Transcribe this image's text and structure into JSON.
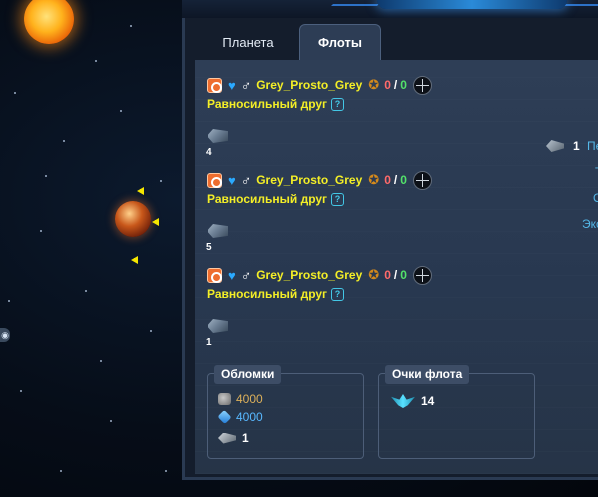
{
  "colors": {
    "accent": "#f3ee27",
    "link": "#55b8e8",
    "metal": "#dcb05a",
    "crystal": "#58b8ff",
    "panel_bg": "#283850",
    "tab_active_bg": "#2d3d55"
  },
  "tabs": [
    {
      "label": "Планета",
      "active": false
    },
    {
      "label": "Флоты",
      "active": true
    }
  ],
  "fleets": [
    {
      "player": "Grey_Prosto_Grey",
      "score_red": "0",
      "separator": "/",
      "score_green": "0",
      "relation": "Равносильный друг",
      "help": "?",
      "ship_count": "4"
    },
    {
      "player": "Grey_Prosto_Grey",
      "score_red": "0",
      "separator": "/",
      "score_green": "0",
      "relation": "Равносильный друг",
      "help": "?",
      "ship_count": "5"
    },
    {
      "player": "Grey_Prosto_Grey",
      "score_red": "0",
      "separator": "/",
      "score_green": "0",
      "relation": "Равносильный друг",
      "help": "?",
      "ship_count": "1"
    }
  ],
  "side_menu": {
    "ship_count": "1",
    "items": [
      "Пер",
      "Т",
      "О",
      "Экс"
    ]
  },
  "debris": {
    "title": "Обломки",
    "metal": "4000",
    "crystal": "4000",
    "ships": "1"
  },
  "fleet_points": {
    "title": "Очки флота",
    "value": "14"
  },
  "icons": {
    "alliance": "alliance-icon",
    "heart": "heart-icon",
    "gender": "male-icon",
    "rank": "rank-badge-icon",
    "target": "crosshair-icon",
    "visibility": "eye-icon"
  }
}
